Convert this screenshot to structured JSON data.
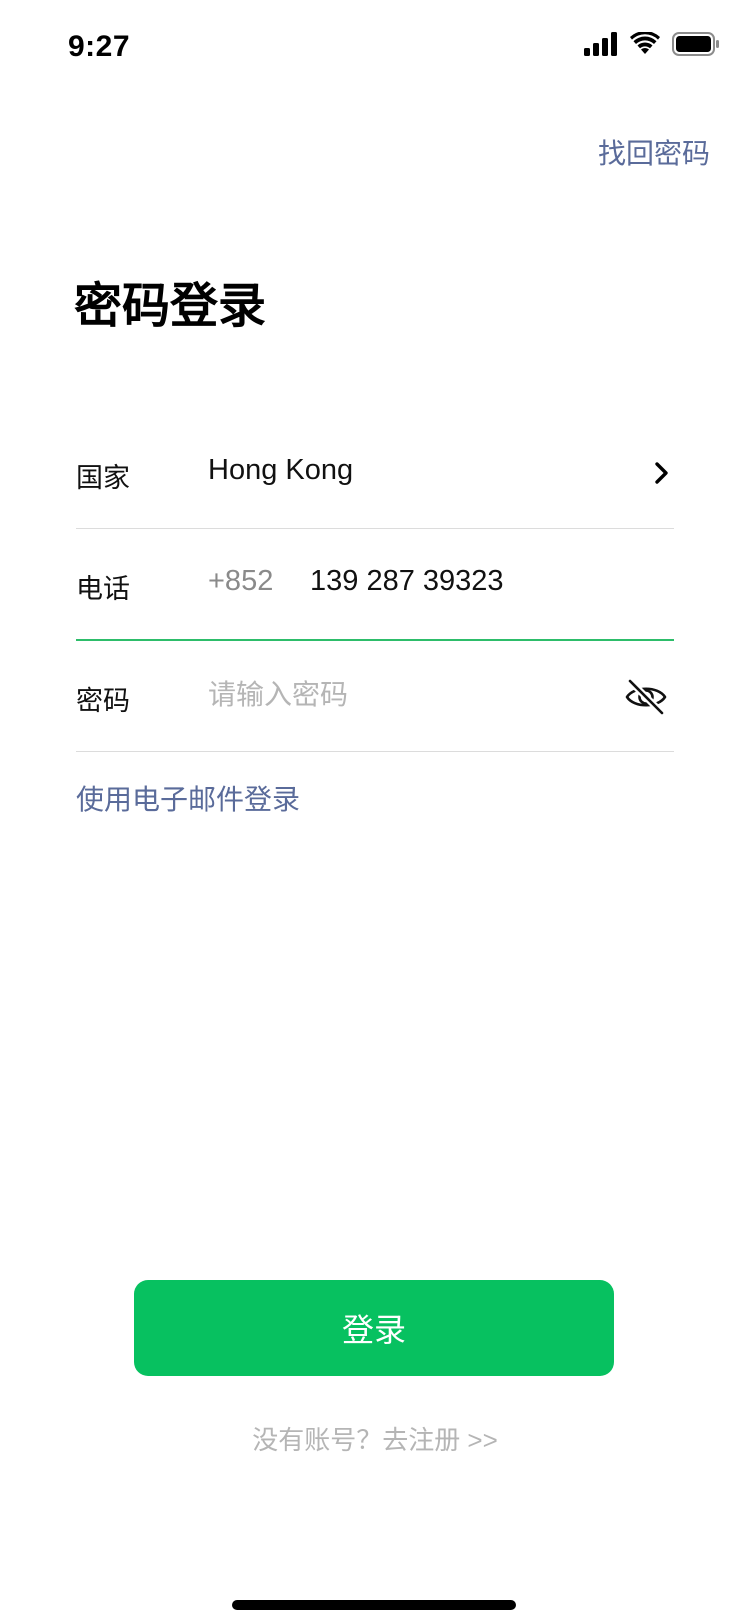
{
  "status_bar": {
    "time": "9:27",
    "icons": [
      "signal-icon",
      "wifi-icon",
      "battery-icon"
    ]
  },
  "header": {
    "forgot_password": "找回密码"
  },
  "title": "密码登录",
  "form": {
    "country": {
      "label": "国家",
      "value": "Hong Kong",
      "icon": "chevron-right-icon"
    },
    "phone": {
      "label": "电话",
      "prefix": "+852",
      "value": "139 287 39323"
    },
    "password": {
      "label": "密码",
      "placeholder": "请输入密码",
      "value": "",
      "toggle_icon": "eye-off-icon"
    }
  },
  "email_login_link": "使用电子邮件登录",
  "login_button": "登录",
  "register_link": "没有账号？去注册 >>",
  "colors": {
    "accent_green": "#07c160",
    "link_blue": "#5a6b9a",
    "active_underline": "#2dbd6a",
    "placeholder_gray": "#b5b5b5"
  }
}
